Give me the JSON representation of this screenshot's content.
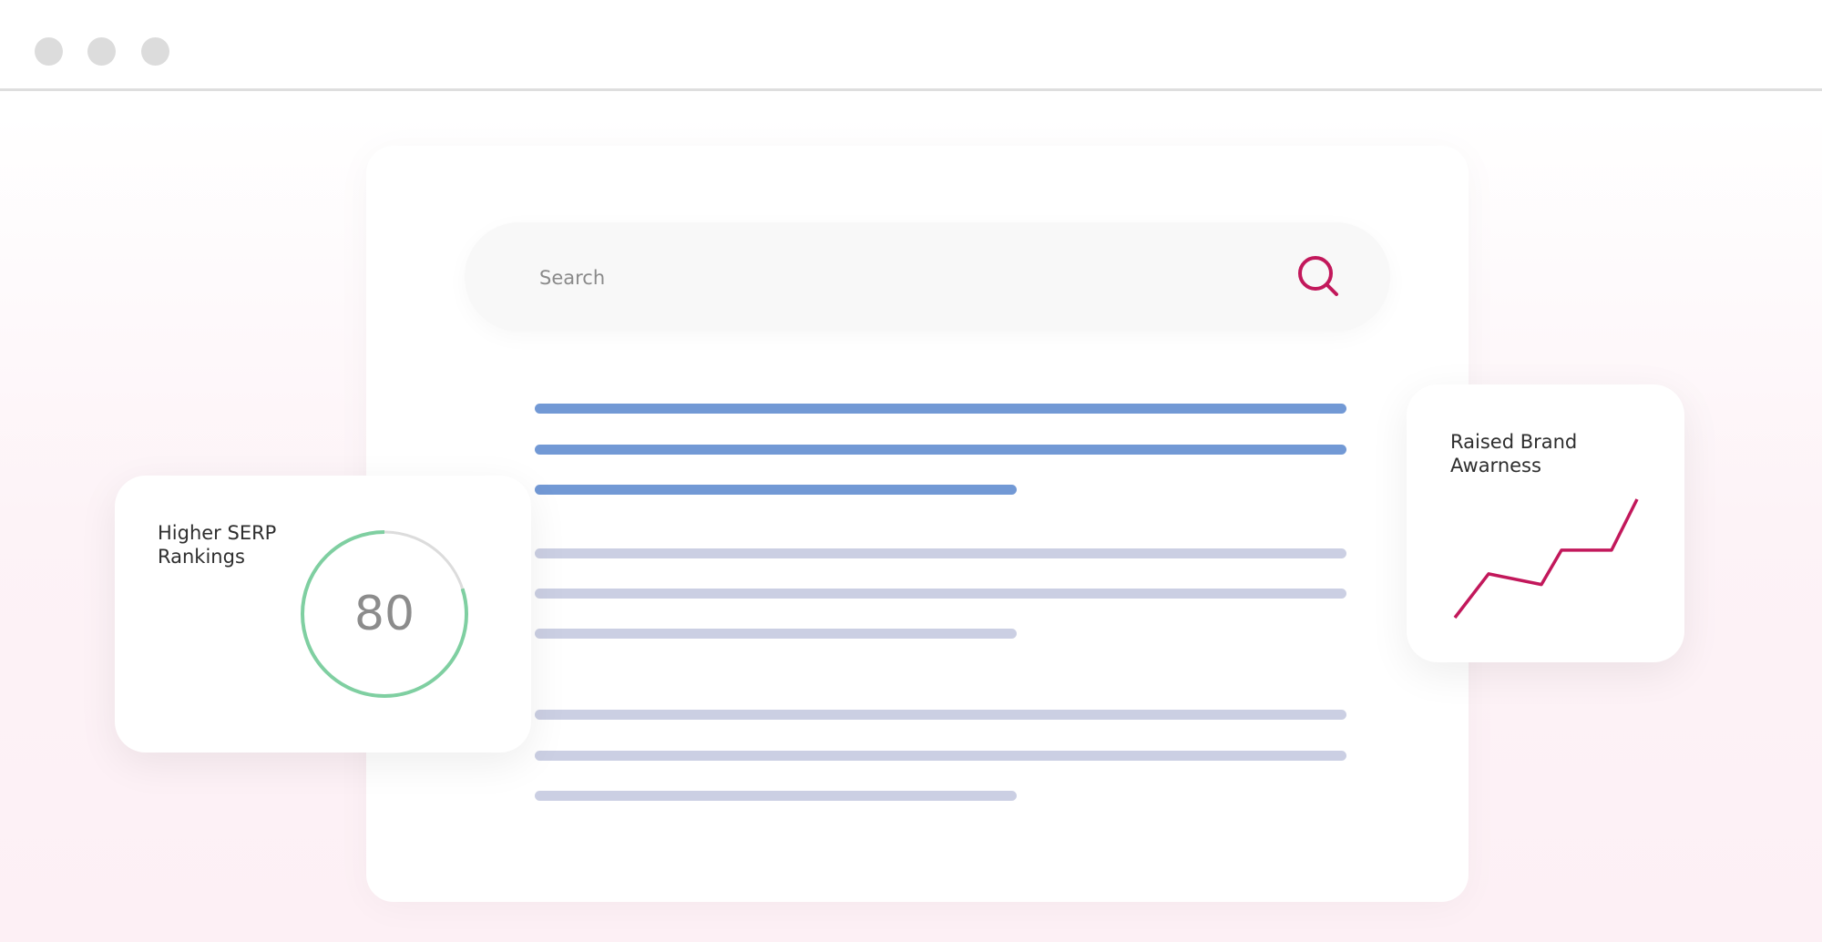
{
  "window": {
    "controls": [
      "window-dot",
      "window-dot",
      "window-dot"
    ]
  },
  "search": {
    "placeholder": "Search",
    "icon": "search-icon",
    "accent_color": "#c2185b"
  },
  "result_lines": {
    "highlight_color": "#7299d5",
    "muted_color": "#cbcfe3"
  },
  "serp_card": {
    "title_line1": "Higher SERP",
    "title_line2": "Rankings",
    "score": "80",
    "score_max": 100,
    "progress_color": "#7fcfa1"
  },
  "brand_card": {
    "title_line1": "Raised Brand",
    "title_line2": "Awarness",
    "trend_color": "#c2185b",
    "trend_values": [
      0,
      37,
      28,
      57,
      57,
      100
    ]
  }
}
